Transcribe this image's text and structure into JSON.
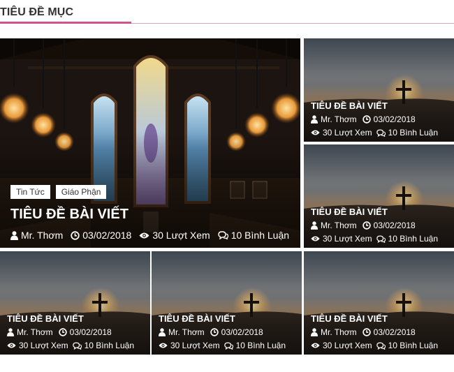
{
  "section": {
    "title": "TIÊU ĐỀ MỤC"
  },
  "colors": {
    "accent": "#d2528e"
  },
  "featured": {
    "tags": [
      "Tin Tức",
      "Giáo Phận"
    ],
    "title": "TIÊU ĐỀ BÀI VIẾT",
    "author": "Mr. Thơm",
    "date": "03/02/2018",
    "views": "30 Lượt Xem",
    "comments": "10 Bình Luận"
  },
  "posts": [
    {
      "title": "TIÊU ĐỀ BÀI VIẾT",
      "author": "Mr. Thơm",
      "date": "03/02/2018",
      "views": "30 Lượt Xem",
      "comments": "10 Bình Luận"
    },
    {
      "title": "TIÊU ĐỀ BÀI VIẾT",
      "author": "Mr. Thơm",
      "date": "03/02/2018",
      "views": "30 Lượt Xem",
      "comments": "10 Bình Luận"
    },
    {
      "title": "TIÊU ĐỀ BÀI VIẾT",
      "author": "Mr. Thơm",
      "date": "03/02/2018",
      "views": "30 Lượt Xem",
      "comments": "10 Bình Luận"
    },
    {
      "title": "TIÊU ĐỀ BÀI VIẾT",
      "author": "Mr. Thơm",
      "date": "03/02/2018",
      "views": "30 Lượt Xem",
      "comments": "10 Bình Luận"
    },
    {
      "title": "TIÊU ĐỀ BÀI VIẾT",
      "author": "Mr. Thơm",
      "date": "03/02/2018",
      "views": "30 Lượt Xem",
      "comments": "10 Bình Luận"
    }
  ]
}
